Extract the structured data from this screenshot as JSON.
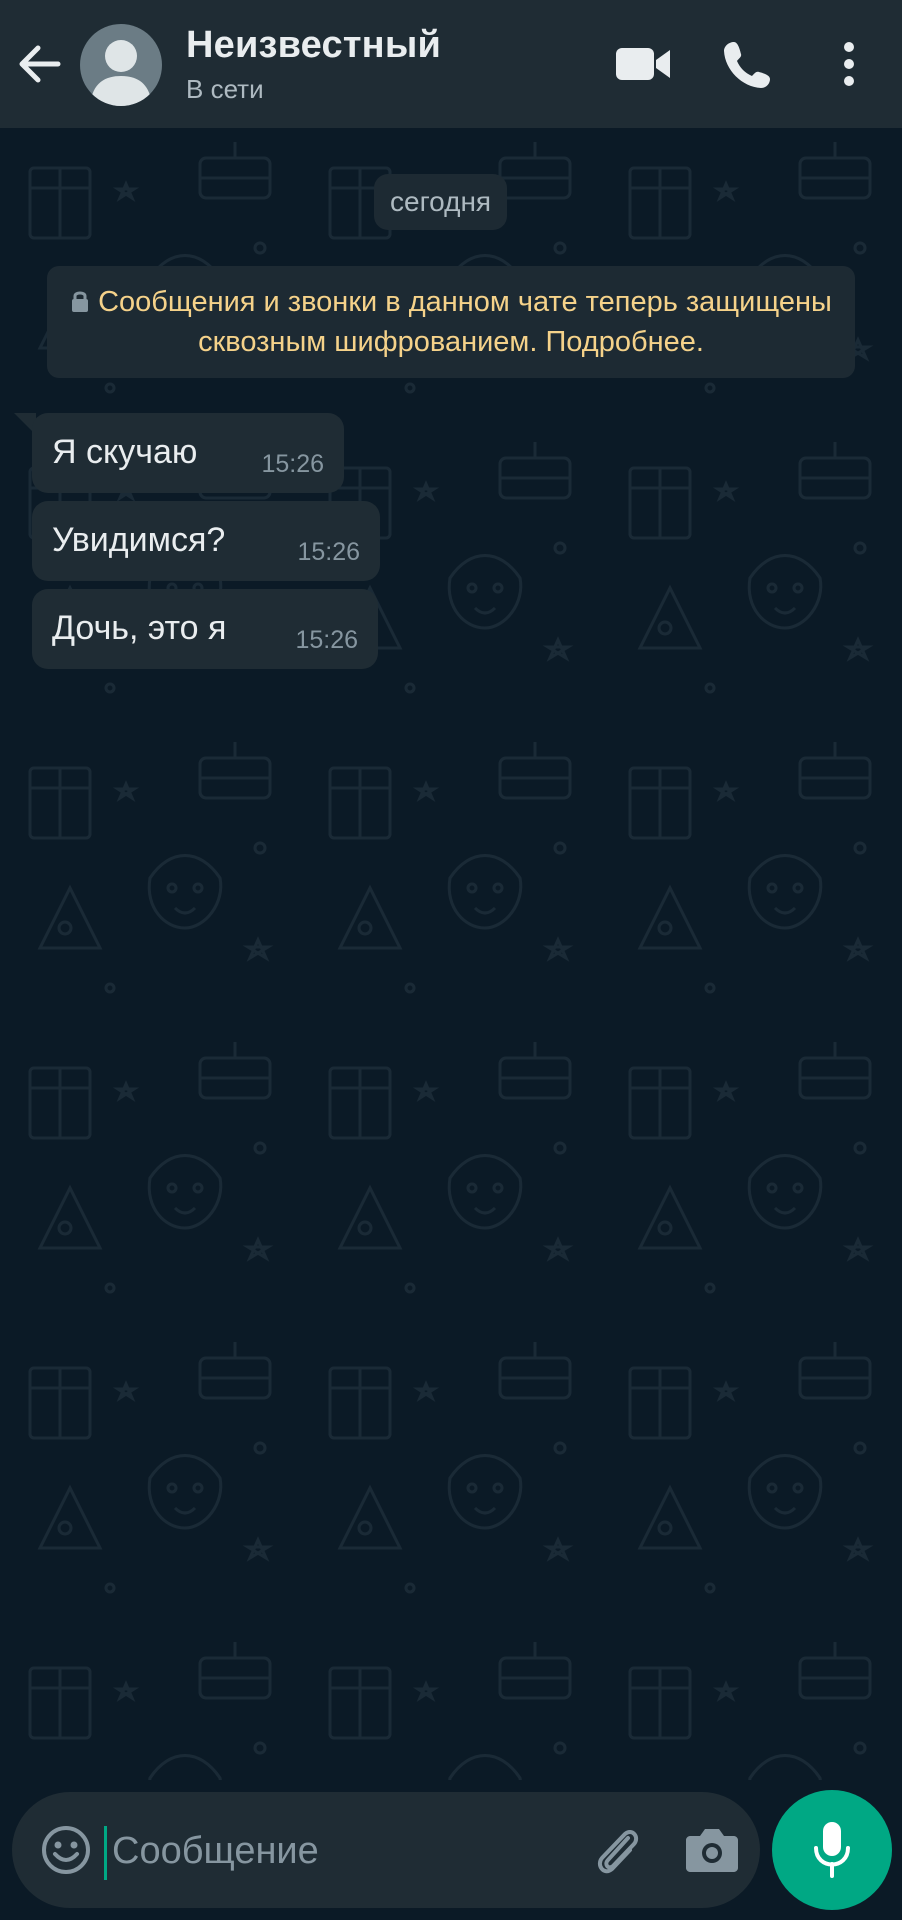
{
  "header": {
    "contact_name": "Неизвестный",
    "status": "В сети",
    "icons": [
      "back-arrow-icon",
      "avatar",
      "video-call-icon",
      "phone-icon",
      "more-vert-icon"
    ]
  },
  "chat": {
    "date_chip": "сегодня",
    "encryption_notice": "Сообщения и звонки в данном чате теперь защищены сквозным шифрованием. Подробнее.",
    "messages": [
      {
        "text": "Я скучаю",
        "time": "15:26"
      },
      {
        "text": "Увидимся?",
        "time": "15:26"
      },
      {
        "text": "Дочь, это я",
        "time": "15:26"
      }
    ]
  },
  "composer": {
    "placeholder": "Сообщение",
    "value": "",
    "icons": [
      "emoji-icon",
      "attach-icon",
      "camera-icon",
      "mic-icon"
    ]
  },
  "colors": {
    "header_bg": "#1f2c34",
    "chat_bg": "#0b1a26",
    "bubble_bg": "#1f2c34",
    "notice_text": "#f5d28a",
    "accent": "#00a884"
  }
}
